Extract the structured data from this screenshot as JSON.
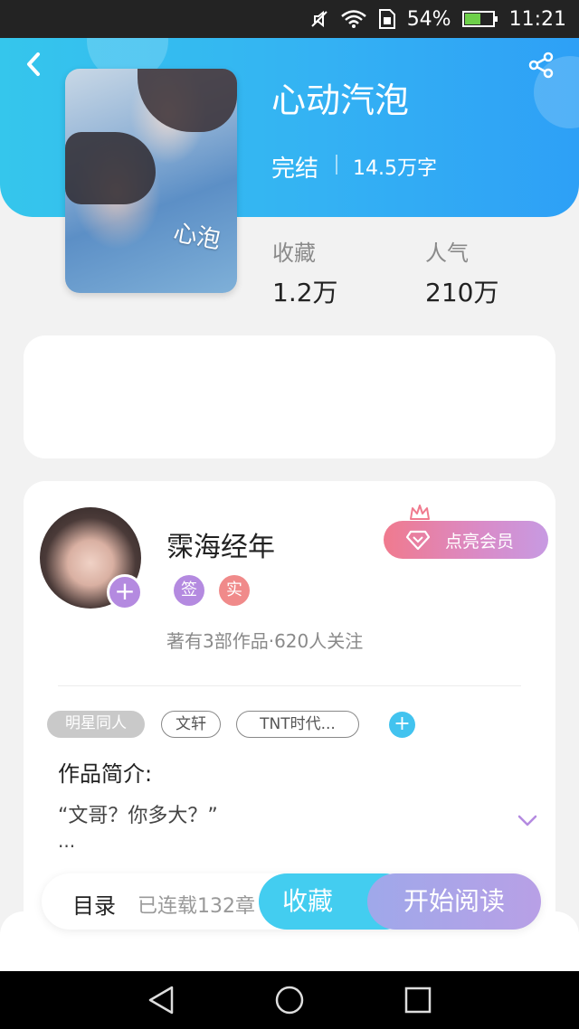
{
  "status_bar": {
    "battery": "54%",
    "time": "11:21",
    "icons": [
      "mute-icon",
      "wifi-icon",
      "sim-icon",
      "battery-icon"
    ]
  },
  "header": {
    "back_icon": "back-chevron-icon",
    "share_icon": "share-icon"
  },
  "book": {
    "cover_title": "心泡",
    "title": "心动汽泡",
    "status": "完结",
    "word_count": "14.5万字",
    "stats": [
      {
        "label": "收藏",
        "value": "1.2万"
      },
      {
        "label": "人气",
        "value": "210万"
      }
    ]
  },
  "author": {
    "name": "霂海经年",
    "follow_icon": "+",
    "badges": [
      {
        "text": "签",
        "color": "#b48ae0"
      },
      {
        "text": "实",
        "color": "#f08a8a"
      }
    ],
    "meta": "著有3部作品·620人关注",
    "vip_label": "点亮会员"
  },
  "tags": [
    {
      "label": "明星同人",
      "style": "fill"
    },
    {
      "label": "文轩",
      "style": "outline"
    },
    {
      "label": "TNT时代...",
      "style": "outline"
    }
  ],
  "tag_add": "+",
  "intro": {
    "title": "作品简介:",
    "text": "“文哥？你多大？”",
    "more": "..."
  },
  "bottom_bar": {
    "toc_label": "目录",
    "toc_count": "已连载132章",
    "collect_label": "收藏",
    "read_label": "开始阅读"
  },
  "colors": {
    "header_start": "#35c6ec",
    "header_end": "#2ea0f6",
    "accent_cyan": "#43cdf0",
    "accent_purple": "#b48ae0"
  }
}
